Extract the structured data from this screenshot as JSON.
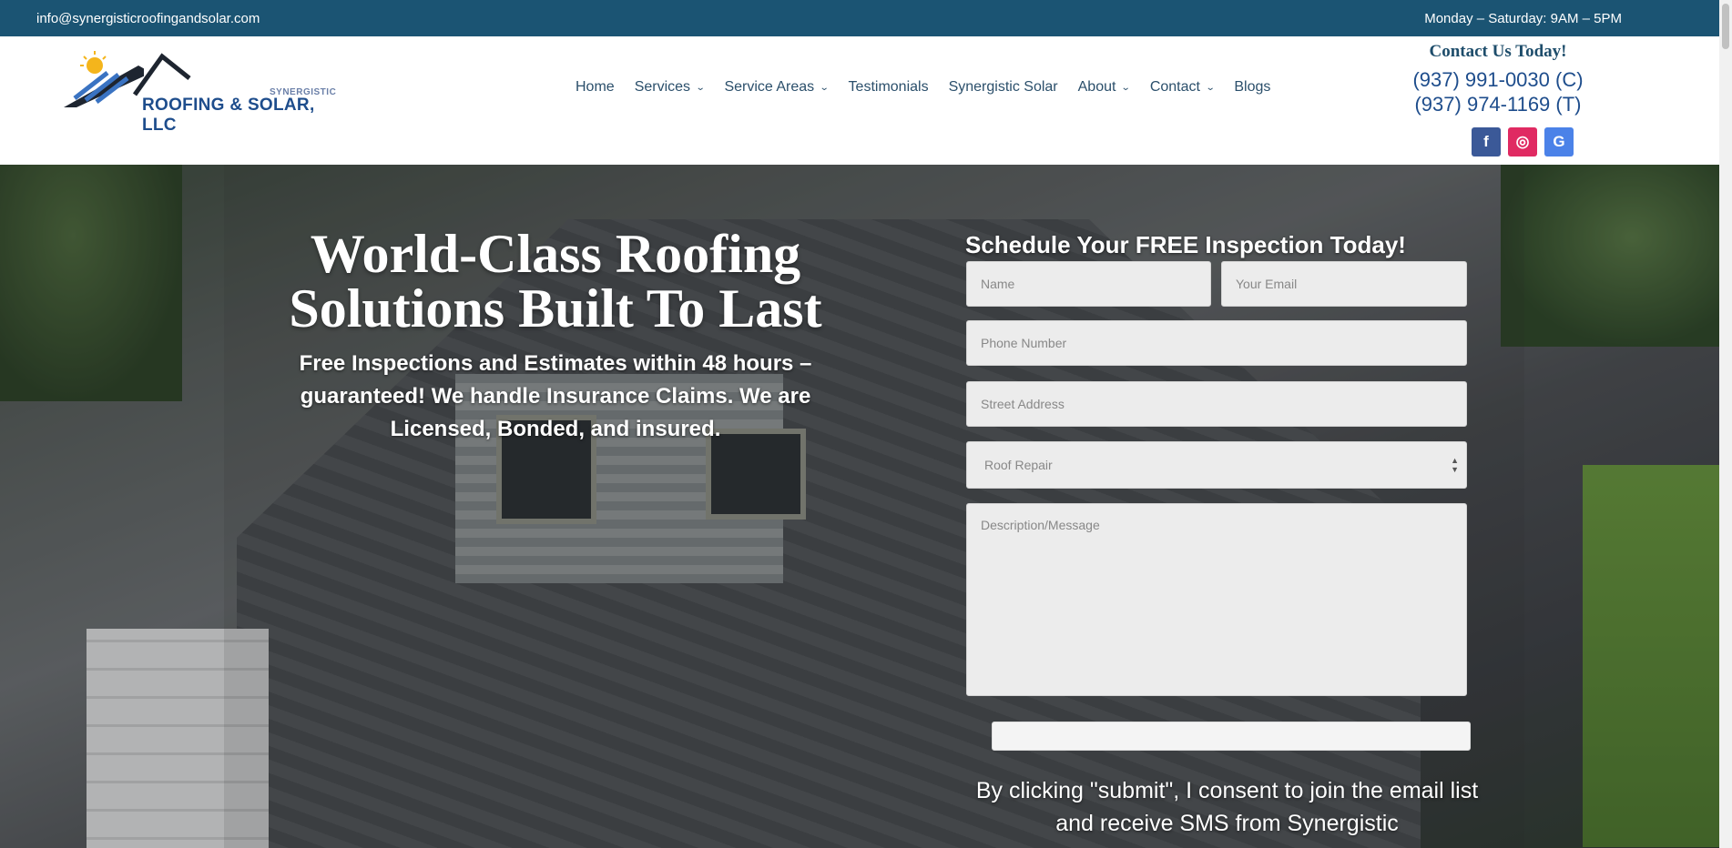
{
  "topbar": {
    "email": "info@synergisticroofingandsolar.com",
    "hours": "Monday – Saturday: 9AM – 5PM"
  },
  "logo": {
    "small": "SYNERGISTIC",
    "big": "ROOFING & SOLAR, LLC"
  },
  "nav": [
    {
      "label": "Home",
      "dropdown": false
    },
    {
      "label": "Services",
      "dropdown": true
    },
    {
      "label": "Service Areas",
      "dropdown": true
    },
    {
      "label": "Testimonials",
      "dropdown": false
    },
    {
      "label": "Synergistic Solar",
      "dropdown": false
    },
    {
      "label": "About",
      "dropdown": true
    },
    {
      "label": "Contact",
      "dropdown": true
    },
    {
      "label": "Blogs",
      "dropdown": false
    }
  ],
  "contact": {
    "cta": "Contact Us Today!",
    "phone_c": "(937) 991-0030 (C)",
    "phone_t": "(937) 974-1169 (T)"
  },
  "social": {
    "facebook": "f",
    "instagram": "◎",
    "google": "G"
  },
  "hero": {
    "headline": "World-Class Roofing Solutions Built To Last",
    "sub": "Free Inspections and Estimates within 48 hours – guaranteed! We handle Insurance Claims. We are Licensed, Bonded, and insured."
  },
  "form": {
    "title": "Schedule Your FREE Inspection Today!",
    "name_placeholder": "Name",
    "email_placeholder": "Your Email",
    "phone_placeholder": "Phone Number",
    "street_placeholder": "Street Address",
    "service_selected": "Roof Repair",
    "message_placeholder": "Description/Message",
    "consent": "By clicking \"submit\", I consent to join the email list and receive SMS from Synergistic"
  },
  "colors": {
    "topbar": "#1b5473",
    "nav_text": "#2b4f6b",
    "phone": "#1e4d8c"
  }
}
